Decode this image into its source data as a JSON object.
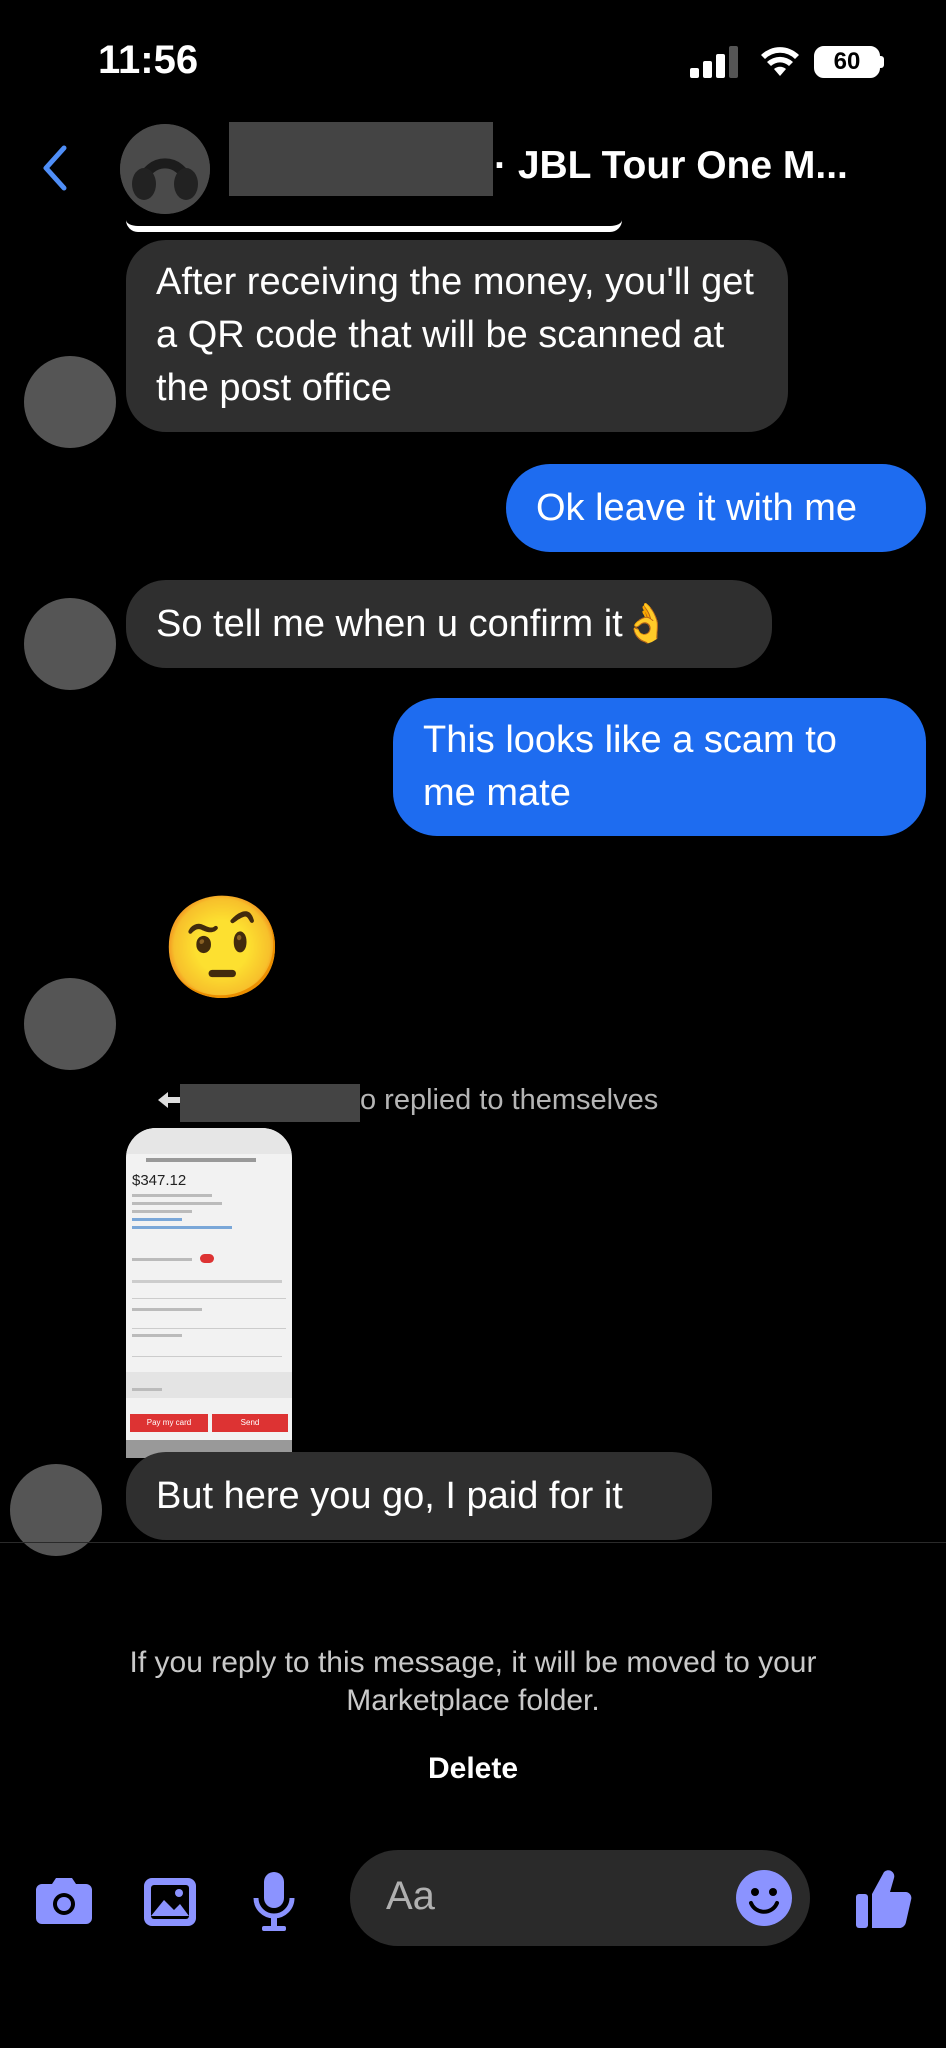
{
  "status_bar": {
    "time": "11:56",
    "battery": "60"
  },
  "header": {
    "title": "· JBL Tour One M...",
    "back_icon": "chevron-left-icon"
  },
  "messages": [
    {
      "direction": "incoming",
      "text": "After receiving the money, you'll get a QR code that will be scanned at the post office"
    },
    {
      "direction": "outgoing",
      "text": "Ok leave it with me"
    },
    {
      "direction": "incoming",
      "text": "So tell me when u confirm it👌"
    },
    {
      "direction": "outgoing",
      "text": "This looks like a scam to me mate"
    },
    {
      "direction": "incoming",
      "text": "🤨"
    },
    {
      "direction": "incoming",
      "text": "But here you go, I paid for it"
    }
  ],
  "reply_note": "o replied to themselves",
  "screenshot": {
    "amount": "$347.12",
    "pay_label": "Pay my card",
    "send_label": "Send"
  },
  "notice": "If you reply to this message, it will be moved to your Marketplace folder.",
  "delete_label": "Delete",
  "composer": {
    "placeholder": "Aa"
  },
  "colors": {
    "accent": "#1e6cf0",
    "icon": "#8b93ff",
    "incoming_bubble": "#2f2f2f"
  }
}
